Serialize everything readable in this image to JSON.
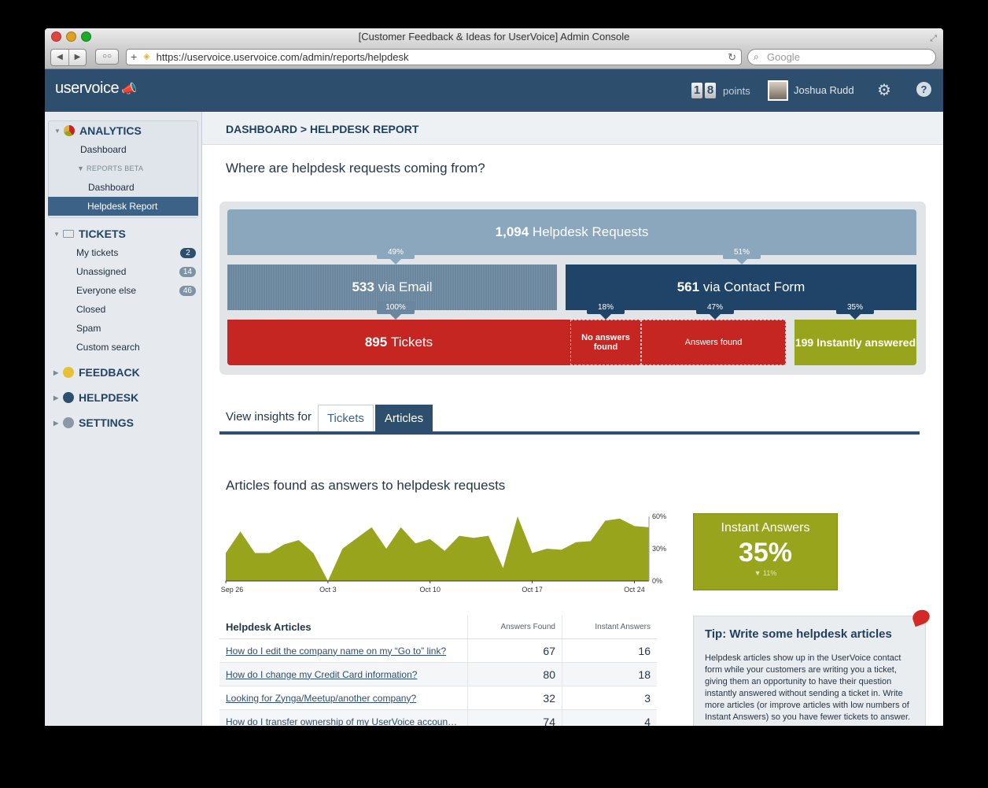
{
  "browser": {
    "title": "[Customer Feedback & Ideas for UserVoice] Admin Console",
    "url": "https://uservoice.uservoice.com/admin/reports/helpdesk",
    "search_placeholder": "Google"
  },
  "header": {
    "logo": "uservoice",
    "points_digits": [
      "1",
      "8"
    ],
    "points_label": "points",
    "user_name": "Joshua Rudd"
  },
  "sidebar": {
    "analytics": {
      "label": "ANALYTICS",
      "items": {
        "dashboard": "Dashboard",
        "reports_beta": "REPORTS BETA",
        "reports_dashboard": "Dashboard",
        "helpdesk_report": "Helpdesk Report"
      }
    },
    "tickets": {
      "label": "TICKETS",
      "items": [
        {
          "label": "My tickets",
          "count": "2"
        },
        {
          "label": "Unassigned",
          "count": "14"
        },
        {
          "label": "Everyone else",
          "count": "46"
        },
        {
          "label": "Closed",
          "count": ""
        },
        {
          "label": "Spam",
          "count": ""
        },
        {
          "label": "Custom search",
          "count": ""
        }
      ]
    },
    "feedback": "FEEDBACK",
    "helpdesk": "HELPDESK",
    "settings": "SETTINGS"
  },
  "content": {
    "breadcrumb": "DASHBOARD > HELPDESK REPORT",
    "heading": "Where are helpdesk requests coming from?",
    "funnel": {
      "requests_count": "1,094",
      "requests_label": "Helpdesk Requests",
      "email_pct": "49%",
      "form_pct": "51%",
      "email_count": "533",
      "email_label": "via Email",
      "form_count": "561",
      "form_label": "via Contact Form",
      "tickets_pct": "100%",
      "noans_pct": "18%",
      "found_pct": "47%",
      "inst_pct": "35%",
      "tickets_count": "895",
      "tickets_label": "Tickets",
      "noans_label": "No answers found",
      "found_label": "Answers found",
      "inst_label": "199 Instantly answered"
    },
    "tabs": {
      "label": "View insights for",
      "tickets": "Tickets",
      "articles": "Articles"
    },
    "articles_heading": "Articles found as answers to helpdesk requests",
    "instant_answers": {
      "title": "Instant Answers",
      "value": "35%",
      "delta": "▼ 11%"
    },
    "table": {
      "headers": [
        "Helpdesk Articles",
        "Answers Found",
        "Instant Answers"
      ],
      "rows": [
        {
          "title": "How do I edit the company name on my “Go to” link?",
          "found": "67",
          "instant": "16"
        },
        {
          "title": "How do I change my Credit Card information?",
          "found": "80",
          "instant": "18"
        },
        {
          "title": "Looking for Zynga/Meetup/another company?",
          "found": "32",
          "instant": "3"
        },
        {
          "title": "How do I transfer ownership of my UserVoice accoun…",
          "found": "74",
          "instant": "4"
        }
      ]
    },
    "tip": {
      "title": "Tip: Write some helpdesk articles",
      "body": "Helpdesk articles show up in the UserVoice contact form while your customers are writing you a ticket, giving them an opportunity to have their question instantly answered without sending a ticket in. Write more articles (or improve articles with low numbers of Instant Answers) so you have fewer tickets to answer."
    }
  },
  "chart_data": {
    "type": "area",
    "x_tick_labels": [
      "Sep 26",
      "Oct 3",
      "Oct 10",
      "Oct 17",
      "Oct 24"
    ],
    "y_tick_labels": [
      "60%",
      "30%",
      "0%"
    ],
    "ylim": [
      0,
      60
    ],
    "color": "#98a51c",
    "values": [
      26,
      46,
      26,
      26,
      34,
      38,
      26,
      0,
      30,
      40,
      50,
      30,
      50,
      35,
      39,
      28,
      42,
      40,
      42,
      12,
      60,
      26,
      30,
      29,
      36,
      37,
      56,
      58,
      51,
      50
    ]
  }
}
